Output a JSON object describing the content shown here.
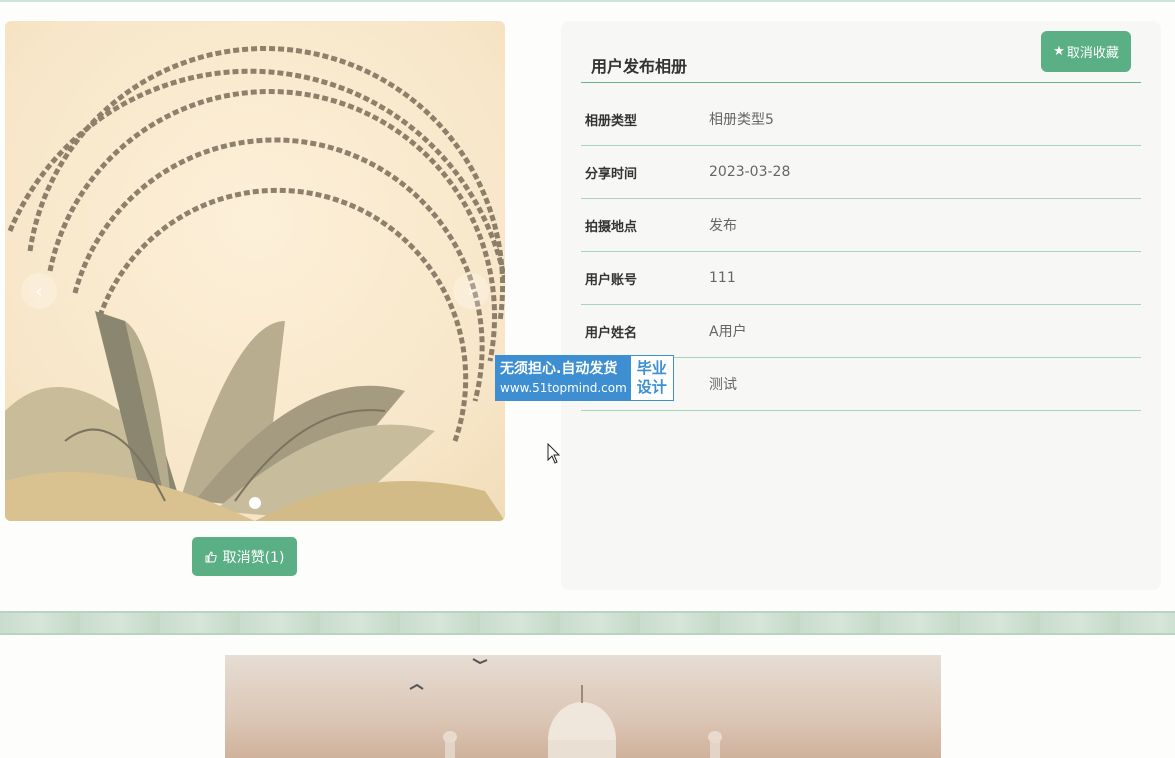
{
  "carousel": {
    "prev_icon": "chevron-left-icon",
    "next_icon": "chevron-right-icon",
    "active_slide": 1,
    "slide_count": 1
  },
  "like_button": {
    "label": "取消赞(1)",
    "icon": "thumbs-up-icon"
  },
  "panel": {
    "title": "用户发布相册",
    "favorite_button": {
      "label": "取消收藏",
      "icon": "star-icon"
    },
    "rows": [
      {
        "label": "相册类型",
        "value": "相册类型5"
      },
      {
        "label": "分享时间",
        "value": "2023-03-28"
      },
      {
        "label": "拍摄地点",
        "value": "发布"
      },
      {
        "label": "用户账号",
        "value": "111"
      },
      {
        "label": "用户姓名",
        "value": "A用户"
      },
      {
        "label": "",
        "value": "测试"
      }
    ]
  },
  "watermark": {
    "line1": "无须担心.自动发货",
    "line2": "www.51topmind.com",
    "right1": "毕业",
    "right2": "设计"
  },
  "colors": {
    "accent": "#5aaf85",
    "panel_bg": "#f7f7f6",
    "divider": "#a9d4bc",
    "watermark_blue": "#3d8fd1"
  }
}
